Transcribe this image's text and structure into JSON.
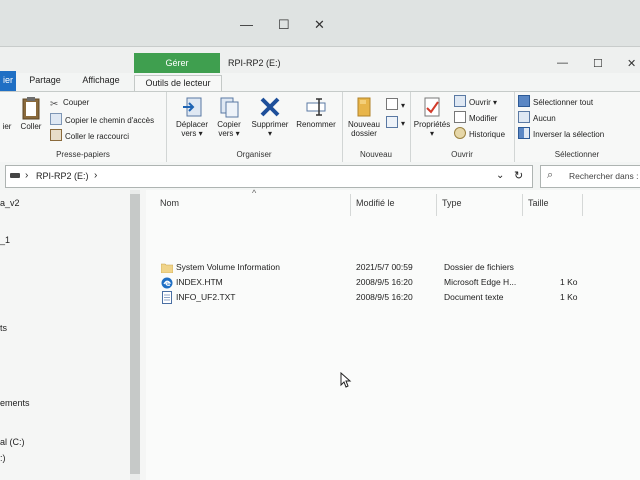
{
  "background_window": {
    "minimize": "—",
    "maximize": "☐",
    "close": "✕"
  },
  "window": {
    "title": "RPI-RP2 (E:)",
    "minimize": "—",
    "maximize": "☐",
    "close": "✕"
  },
  "tabs": {
    "file": "ier",
    "share": "Partage",
    "view": "Affichage",
    "manage": "Gérer",
    "drive_tools": "Outils de lecteur"
  },
  "ribbon": {
    "clipboard": {
      "label": "Presse-papiers",
      "pin": "ier",
      "paste": "Coller",
      "cut": "Couper",
      "copy_path": "Copier le chemin d'accès",
      "paste_shortcut": "Coller le raccourci"
    },
    "organize": {
      "label": "Organiser",
      "move_to": [
        "Déplacer",
        "vers"
      ],
      "copy_to": [
        "Copier",
        "vers"
      ],
      "delete": "Supprimer",
      "rename": "Renommer"
    },
    "new": {
      "label": "Nouveau",
      "new_folder": [
        "Nouveau",
        "dossier"
      ]
    },
    "open": {
      "label": "Ouvrir",
      "properties": "Propriétés",
      "open": "Ouvrir",
      "edit": "Modifier",
      "history": "Historique"
    },
    "select": {
      "label": "Sélectionner",
      "select_all": "Sélectionner tout",
      "select_none": "Aucun",
      "invert": "Inverser la sélection"
    }
  },
  "address": {
    "path": "RPI-RP2 (E:)",
    "search_placeholder": "Rechercher dans :"
  },
  "navigation": {
    "items": [
      "a_v2",
      "_1",
      "ts",
      "ements",
      "al (C:)",
      ":)"
    ]
  },
  "file_list": {
    "columns": {
      "name": "Nom",
      "modified": "Modifié le",
      "type": "Type",
      "size": "Taille"
    },
    "rows": [
      {
        "name": "System Volume Information",
        "modified": "2021/5/7 00:59",
        "type": "Dossier de fichiers",
        "size": "",
        "icon": "folder-icon"
      },
      {
        "name": "INDEX.HTM",
        "modified": "2008/9/5 16:20",
        "type": "Microsoft Edge H...",
        "size": "1 Ko",
        "icon": "edge-icon"
      },
      {
        "name": "INFO_UF2.TXT",
        "modified": "2008/9/5 16:20",
        "type": "Document texte",
        "size": "1 Ko",
        "icon": "text-file-icon"
      }
    ]
  },
  "colors": {
    "manage_tab": "#3f9f4f",
    "file_tab": "#1f6fc4",
    "delete_x": "#1e4f9a"
  }
}
